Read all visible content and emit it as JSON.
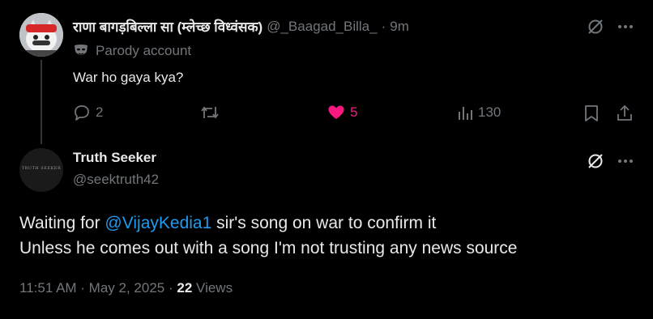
{
  "tweet1": {
    "display_name": "राणा बागड़बिल्ला सा (म्लेच्छ विध्वंसक)",
    "handle": "@_Baagad_Billa_",
    "separator": "·",
    "time_ago": "9m",
    "parody_label": "Parody account",
    "text": "War ho gaya kya?",
    "replies": "2",
    "likes": "5",
    "views": "130"
  },
  "tweet2": {
    "display_name": "Truth Seeker",
    "handle": "@seektruth42",
    "avatar_text": "TRUTH SEEKER",
    "text_pre": "Waiting for ",
    "mention": "@VijayKedia1",
    "text_post": " sir's song on war to confirm it",
    "text_line2": "Unless he comes out with a song I'm not trusting any news source",
    "timestamp": "11:51 AM · May 2, 2025",
    "separator": "·",
    "views_count": "22",
    "views_label": "Views"
  },
  "colors": {
    "background": "#000000",
    "text": "#e7e9ea",
    "muted": "#71767b",
    "like": "#f91880",
    "link": "#1d9bf0"
  },
  "icons": [
    "grok-icon",
    "more-icon",
    "mask-icon",
    "reply-icon",
    "retweet-icon",
    "heart-icon",
    "views-icon",
    "bookmark-icon",
    "share-icon"
  ]
}
